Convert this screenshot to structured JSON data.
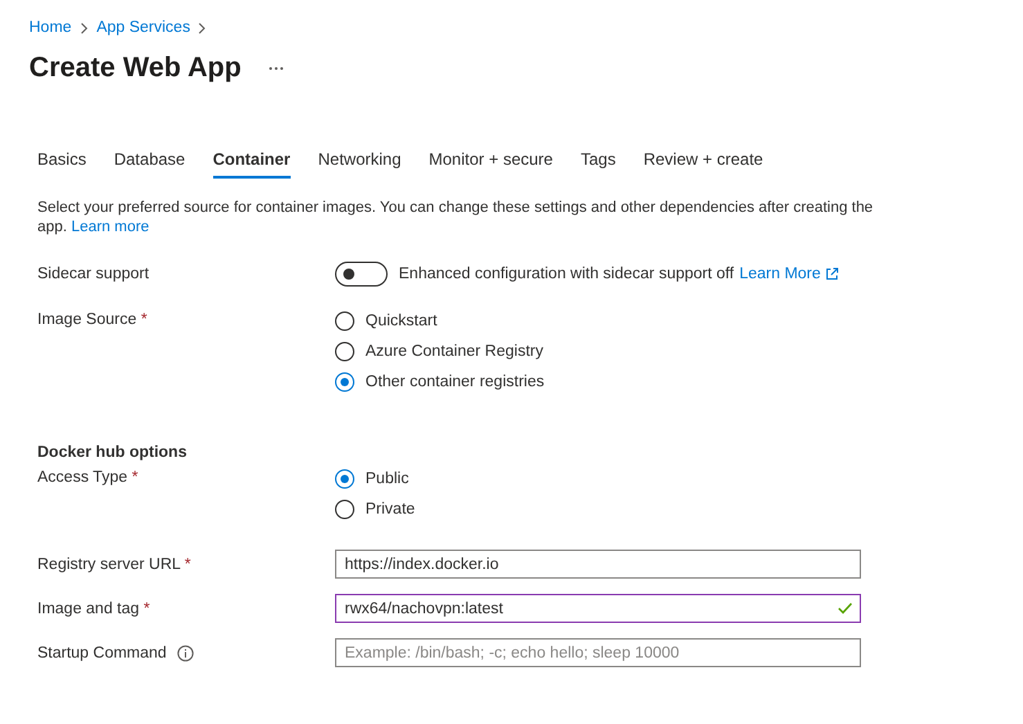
{
  "breadcrumb": [
    {
      "label": "Home"
    },
    {
      "label": "App Services"
    }
  ],
  "title": "Create Web App",
  "tabs": [
    {
      "label": "Basics",
      "selected": false
    },
    {
      "label": "Database",
      "selected": false
    },
    {
      "label": "Container",
      "selected": true
    },
    {
      "label": "Networking",
      "selected": false
    },
    {
      "label": "Monitor + secure",
      "selected": false
    },
    {
      "label": "Tags",
      "selected": false
    },
    {
      "label": "Review + create",
      "selected": false
    }
  ],
  "description": {
    "text": "Select your preferred source for container images. You can change these settings and other dependencies after creating the app.",
    "link": "Learn more"
  },
  "sidecar": {
    "label": "Sidecar support",
    "on": false,
    "text": "Enhanced configuration with sidecar support off",
    "link": "Learn More"
  },
  "image_source": {
    "label": "Image Source",
    "required_mark": "*",
    "options": [
      {
        "label": "Quickstart",
        "selected": false
      },
      {
        "label": "Azure Container Registry",
        "selected": false
      },
      {
        "label": "Other container registries",
        "selected": true
      }
    ]
  },
  "docker_heading": "Docker hub options",
  "access_type": {
    "label": "Access Type",
    "required_mark": "*",
    "options": [
      {
        "label": "Public",
        "selected": true
      },
      {
        "label": "Private",
        "selected": false
      }
    ]
  },
  "inputs": [
    {
      "label": "Registry server URL",
      "required_mark": "*",
      "value": "https://index.docker.io",
      "focused": false
    },
    {
      "label": "Image and tag",
      "required_mark": "*",
      "value": "rwx64/nachovpn:latest",
      "focused": true,
      "valid": true
    },
    {
      "label": "Startup Command",
      "placeholder": "Example: /bin/bash; -c; echo hello; sleep 10000",
      "focused": false,
      "info": true
    }
  ]
}
